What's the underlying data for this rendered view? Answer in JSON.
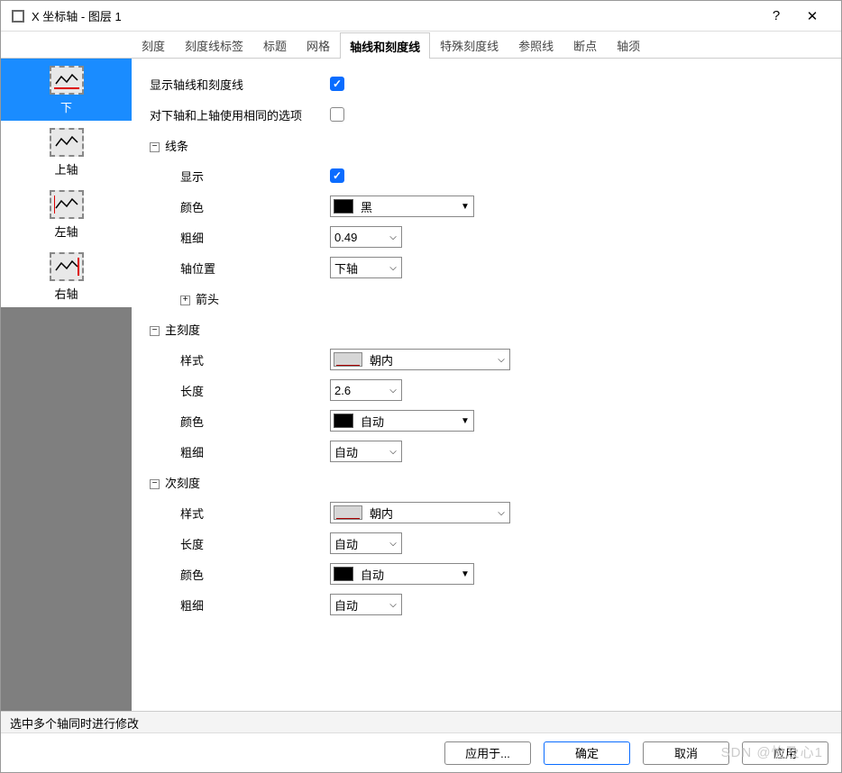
{
  "window": {
    "title": "X 坐标轴 - 图层 1",
    "help": "?",
    "close": "✕"
  },
  "tabs": [
    {
      "label": "刻度",
      "active": false
    },
    {
      "label": "刻度线标签",
      "active": false
    },
    {
      "label": "标题",
      "active": false
    },
    {
      "label": "网格",
      "active": false
    },
    {
      "label": "轴线和刻度线",
      "active": true
    },
    {
      "label": "特殊刻度线",
      "active": false
    },
    {
      "label": "参照线",
      "active": false
    },
    {
      "label": "断点",
      "active": false
    },
    {
      "label": "轴须",
      "active": false
    }
  ],
  "sidebar": [
    {
      "label": "下",
      "selected": true
    },
    {
      "label": "上轴",
      "selected": false
    },
    {
      "label": "左轴",
      "selected": false
    },
    {
      "label": "右轴",
      "selected": false
    }
  ],
  "rows": {
    "show_all_label": "显示轴线和刻度线",
    "same_opts_label": "对下轴和上轴使用相同的选项",
    "section_line": "线条",
    "line_show": "显示",
    "line_color": "颜色",
    "line_color_val": "黑",
    "line_thick": "粗细",
    "line_thick_val": "0.49",
    "axis_pos": "轴位置",
    "axis_pos_val": "下轴",
    "arrow": "箭头",
    "section_major": "主刻度",
    "major_style": "样式",
    "major_style_val": "朝内",
    "major_len": "长度",
    "major_len_val": "2.6",
    "major_color": "颜色",
    "major_color_val": "自动",
    "major_thick": "粗细",
    "major_thick_val": "自动",
    "section_minor": "次刻度",
    "minor_style": "样式",
    "minor_style_val": "朝内",
    "minor_len": "长度",
    "minor_len_val": "自动",
    "minor_color": "颜色",
    "minor_color_val": "自动",
    "minor_thick": "粗细",
    "minor_thick_val": "自动"
  },
  "tree": {
    "minus": "−",
    "plus": "+"
  },
  "status": "选中多个轴同时进行修改",
  "footer": {
    "apply_to": "应用于...",
    "ok": "确定",
    "cancel": "取消",
    "apply": "应用"
  },
  "watermark": "SDN @怡及心1"
}
